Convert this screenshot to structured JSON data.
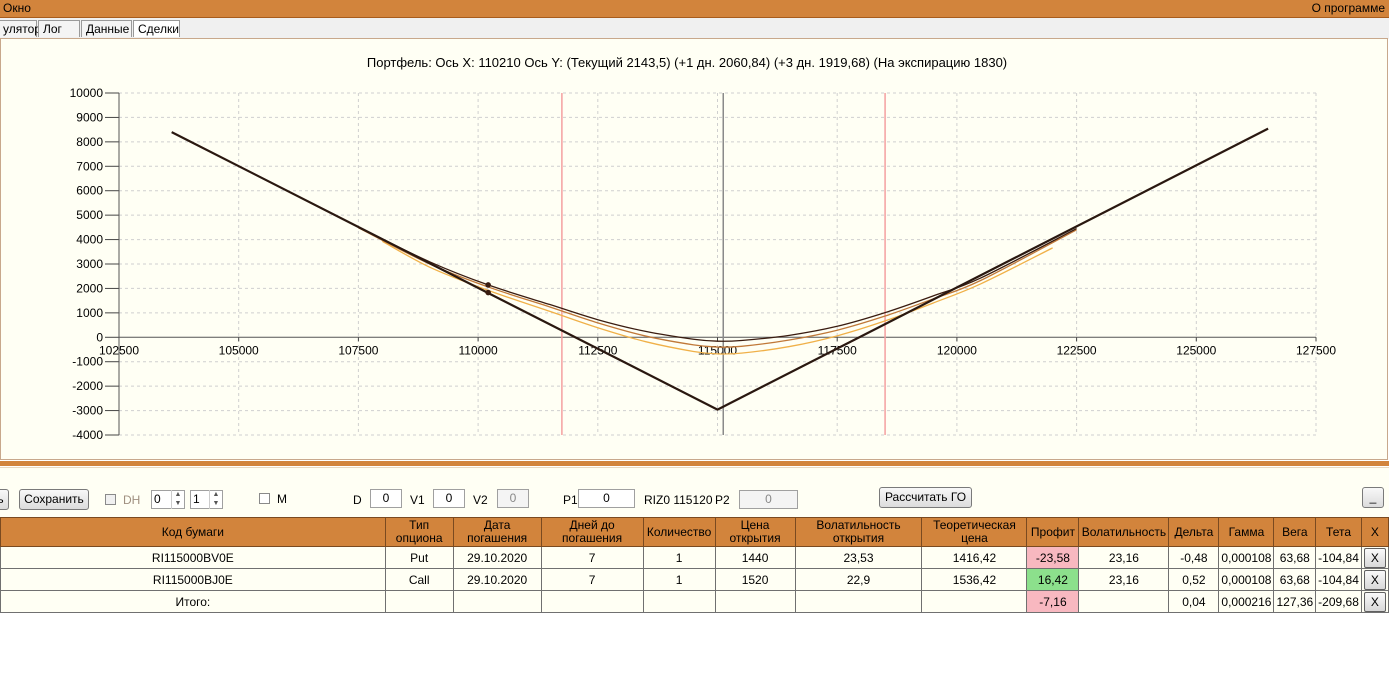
{
  "menu": {
    "left": "Окно",
    "right": "О программе"
  },
  "tabs": [
    "улятор",
    "Лог",
    "Данные",
    "Сделки"
  ],
  "chart_data": {
    "type": "line",
    "title": "Портфель: Ось X: 110210 Ось Y:  (Текущий 2143,5)  (+1 дн. 2060,84)  (+3 дн. 1919,68)  (На экспирацию 1830)",
    "xlim": [
      102500,
      127500
    ],
    "ylim": [
      -4000,
      10000
    ],
    "x_ticks": [
      102500,
      105000,
      107500,
      110000,
      112500,
      115000,
      117500,
      120000,
      122500,
      125000,
      127500
    ],
    "y_ticks": [
      10000,
      9000,
      8000,
      7000,
      6000,
      5000,
      4000,
      3000,
      2000,
      1000,
      0,
      -1000,
      -2000,
      -3000,
      -4000
    ],
    "grid": true,
    "vertical_markers": [
      {
        "x": 111750,
        "color": "#f4a0a0"
      },
      {
        "x": 115120,
        "color": "#8a8a8a"
      },
      {
        "x": 118500,
        "color": "#f4a0a0"
      }
    ],
    "series": [
      {
        "color": "#2a1810",
        "x": [
          103600,
          115000,
          126500
        ],
        "y": [
          8400,
          -2960,
          8540
        ]
      },
      {
        "color": "#3a1c10",
        "x": [
          107500,
          109000,
          110210,
          111500,
          112500,
          113500,
          114500,
          115000,
          115500,
          116500,
          117500,
          118500,
          119500,
          120500,
          122500
        ],
        "y": [
          4500,
          3080,
          2143.5,
          1340,
          720,
          240,
          -80,
          -160,
          -130,
          80,
          450,
          1010,
          1690,
          2430,
          4450
        ]
      },
      {
        "color": "#c07838",
        "x": [
          107500,
          109000,
          110210,
          111500,
          112500,
          113500,
          114500,
          115000,
          115500,
          116500,
          117500,
          118500,
          119500,
          120500,
          122500
        ],
        "y": [
          4480,
          2990,
          2060.84,
          1240,
          590,
          50,
          -310,
          -400,
          -370,
          -110,
          290,
          870,
          1570,
          2330,
          4400
        ]
      },
      {
        "color": "#f0b048",
        "x": [
          108000,
          109000,
          110210,
          111500,
          112500,
          113500,
          114500,
          115000,
          115500,
          116500,
          117500,
          118500,
          119500,
          120500,
          122000
        ],
        "y": [
          3930,
          2860,
          1919.68,
          1060,
          390,
          -180,
          -580,
          -680,
          -650,
          -380,
          60,
          670,
          1400,
          2190,
          3660
        ]
      }
    ],
    "markers": [
      {
        "x": 110210,
        "y": 2143.5
      },
      {
        "x": 110210,
        "y": 1830
      }
    ]
  },
  "toolbar": {
    "save": "Сохранить",
    "dh": "DH",
    "spin1": "0",
    "spin2": "1",
    "m": "M",
    "d_label": "D",
    "d_value": "0",
    "v1_label": "V1",
    "v1_value": "0",
    "v2_label": "V2",
    "v2_value": "0",
    "p1_label": "P1",
    "p1_value": "0",
    "riz": "RIZ0 115120",
    "p2_label": "P2",
    "p2_value": "0",
    "calc": "Рассчитать ГО",
    "min": "_"
  },
  "table": {
    "headers": [
      "Код бумаги",
      "Тип опциона",
      "Дата погашения",
      "Дней до погашения",
      "Количество",
      "Цена открытия",
      "Волатильность открытия",
      "Теоретическая цена",
      "Профит",
      "Волатильность",
      "Дельта",
      "Гамма",
      "Вега",
      "Тета",
      "X"
    ],
    "rows": [
      {
        "code": "RI115000BV0E",
        "type": "Put",
        "date": "29.10.2020",
        "days": "7",
        "qty": "1",
        "open": "1440",
        "vol_open": "23,53",
        "theo": "1416,42",
        "profit": "-23,58",
        "vol": "23,16",
        "delta": "-0,48",
        "gamma": "0,000108",
        "vega": "63,68",
        "theta": "-104,84",
        "x": "X"
      },
      {
        "code": "RI115000BJ0E",
        "type": "Call",
        "date": "29.10.2020",
        "days": "7",
        "qty": "1",
        "open": "1520",
        "vol_open": "22,9",
        "theo": "1536,42",
        "profit": "16,42",
        "vol": "23,16",
        "delta": "0,52",
        "gamma": "0,000108",
        "vega": "63,68",
        "theta": "-104,84",
        "x": "X"
      }
    ],
    "total": {
      "label": "Итого:",
      "profit": "-7,16",
      "delta": "0,04",
      "gamma": "0,000216",
      "vega": "127,36",
      "theta": "-209,68",
      "x": "X"
    }
  }
}
